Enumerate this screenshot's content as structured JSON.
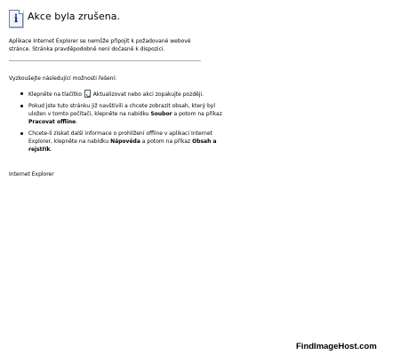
{
  "header": {
    "title": "Akce byla zrušena."
  },
  "description": "Aplikace Internet Explorer se nemůže připojit k požadované webové stránce. Stránka pravděpodobně není dočasně k dispozici.",
  "solutions": {
    "heading": "Vyzkoušejte následující možnosti řešení:",
    "items": [
      {
        "before": "Klepněte na tlačítko",
        "icon": "refresh-page-icon",
        "after": "Aktualizovat nebo akci zopakujte později."
      },
      {
        "before": "Pokud jste tuto stránku již navštívili a chcete zobrazit obsah, který byl uložen v tomto počítači, klepněte na nabídku",
        "menu": "Soubor",
        "middle": "a potom na příkaz",
        "command": "Pracovat offline",
        "after": "."
      },
      {
        "before": "Chcete-li získat další informace o prohlížení offline v aplikaci Internet Explorer, klepněte na nabídku",
        "menu": "Nápověda",
        "middle": "a potom na příkaz",
        "command": "Obsah a rejstřík",
        "after": "."
      }
    ]
  },
  "footer": {
    "brand": "Internet Explorer"
  },
  "watermark": {
    "text": "FindImageHost.com"
  },
  "icons": {
    "header": "info-icon"
  },
  "colors": {
    "icon_blue": "#1b2f92",
    "divider": "#aaaaaa"
  }
}
